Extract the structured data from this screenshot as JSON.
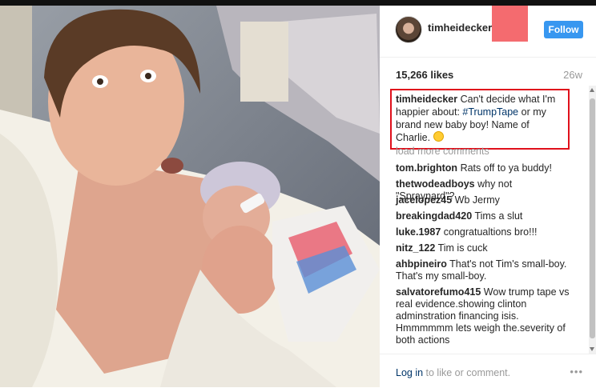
{
  "post": {
    "username": "timheidecker",
    "follow_label": "Follow",
    "likes": "15,266 likes",
    "age": "26w",
    "caption": {
      "user": "timheidecker",
      "text_before": "Can't decide what I'm happier about:",
      "hashtag": "#TrumpTape",
      "text_after": "or my brand new baby boy! Name of Charlie."
    },
    "load_more": "load more comments",
    "comments": [
      {
        "user": "tom.brighton",
        "text": "Rats off to ya buddy!"
      },
      {
        "user": "thetwodeadboys",
        "text": "why not \"Spraynard\"?"
      },
      {
        "user": "jacelopez45",
        "text": "Wb Jermy"
      },
      {
        "user": "breakingdad420",
        "text": "Tims a slut"
      },
      {
        "user": "luke.1987",
        "text": "congratualtions bro!!!"
      },
      {
        "user": "nitz_122",
        "text": "Tim is cuck"
      },
      {
        "user": "ahbpineiro",
        "text": "That's not Tim's small-boy. That's my small-boy."
      },
      {
        "user": "salvatorefumo415",
        "text": "Wow trump tape vs real evidence.showing clinton adminstration financing isis. Hmmmmmm lets weigh the.severity of both actions"
      }
    ],
    "footer": {
      "login_link": "Log in",
      "login_rest": " to like or comment.",
      "more_icon": "ellipsis-icon"
    },
    "colors": {
      "follow": "#3897f0",
      "highlight_box": "#e0101b",
      "red_square": "#f46b6f",
      "hashtag": "#003569"
    }
  }
}
